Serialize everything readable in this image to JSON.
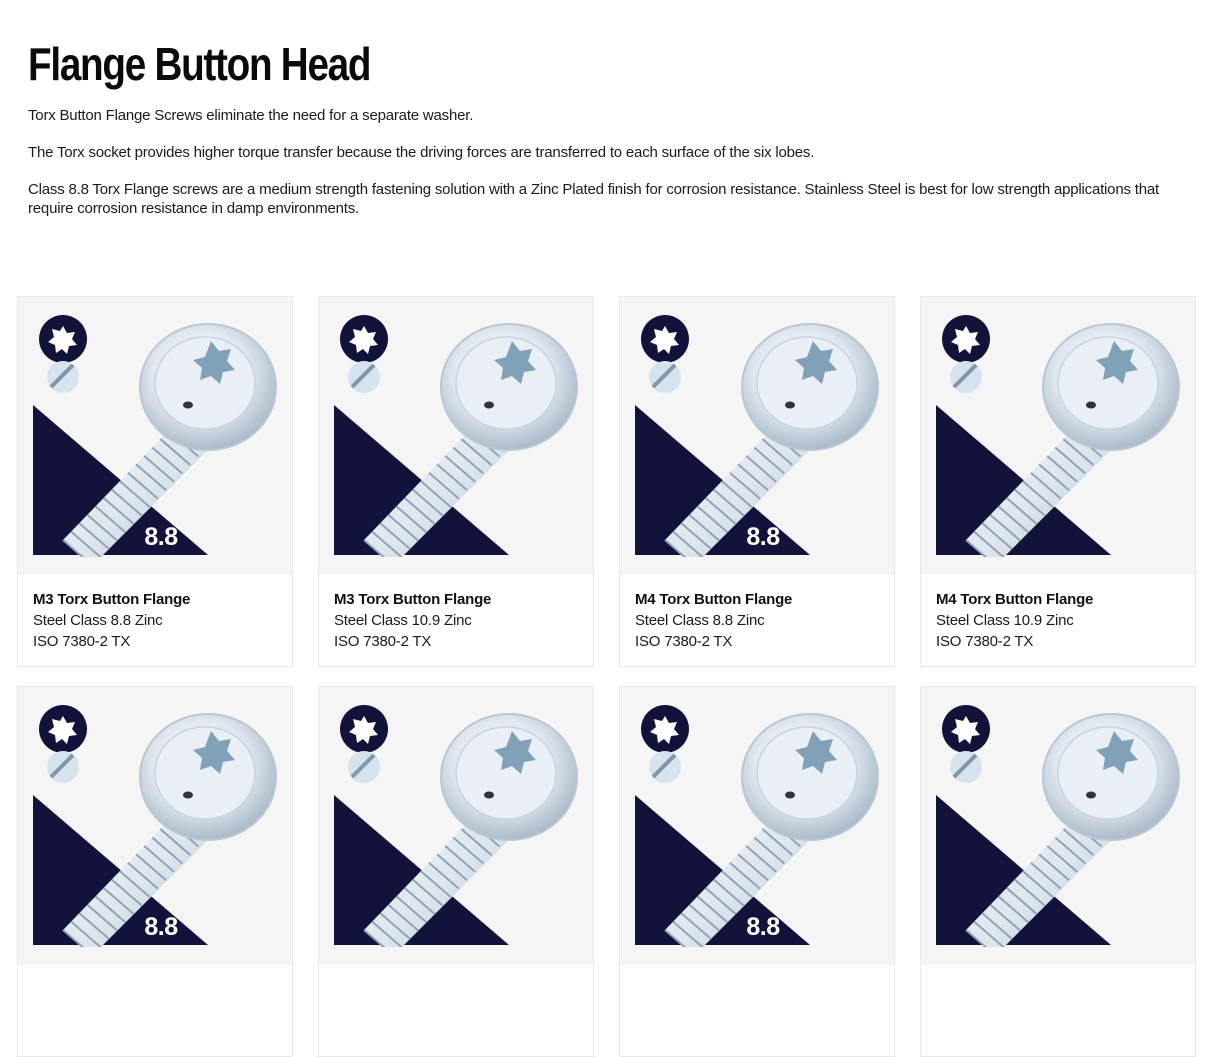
{
  "page": {
    "title": "Flange Button Head",
    "paragraphs": [
      "Torx Button Flange Screws eliminate the need for a separate washer.",
      "The Torx socket provides higher torque transfer because the driving forces are transferred to each surface of the six lobes.",
      "Class 8.8 Torx Flange screws are a medium strength fastening solution with a Zinc Plated finish for corrosion resistance. Stainless Steel is best for low strength applications that require corrosion resistance in damp environments."
    ]
  },
  "colors": {
    "navy": "#12123a",
    "card_bg": "#f5f5f5",
    "screw_light": "#dfe7ee",
    "screw_mid": "#aebfcf"
  },
  "products": [
    {
      "title": "M3 Torx Button Flange",
      "spec": "Steel Class 8.8 Zinc",
      "standard": "ISO 7380-2 TX",
      "grade_badge": "8.8",
      "icon": "torx-drive-icon"
    },
    {
      "title": "M3 Torx Button Flange",
      "spec": "Steel Class 10.9 Zinc",
      "standard": "ISO 7380-2 TX",
      "grade_badge": "",
      "icon": "torx-drive-icon"
    },
    {
      "title": "M4 Torx Button Flange",
      "spec": "Steel Class 8.8 Zinc",
      "standard": "ISO 7380-2 TX",
      "grade_badge": "8.8",
      "icon": "torx-drive-icon"
    },
    {
      "title": "M4 Torx Button Flange",
      "spec": "Steel Class 10.9 Zinc",
      "standard": "ISO 7380-2 TX",
      "grade_badge": "",
      "icon": "torx-drive-icon"
    },
    {
      "title": "",
      "spec": "",
      "standard": "",
      "grade_badge": "8.8",
      "icon": "torx-drive-icon"
    },
    {
      "title": "",
      "spec": "",
      "standard": "",
      "grade_badge": "",
      "icon": "torx-drive-icon"
    },
    {
      "title": "",
      "spec": "",
      "standard": "",
      "grade_badge": "8.8",
      "icon": "torx-drive-icon"
    },
    {
      "title": "",
      "spec": "",
      "standard": "",
      "grade_badge": "",
      "icon": "torx-drive-icon"
    }
  ]
}
